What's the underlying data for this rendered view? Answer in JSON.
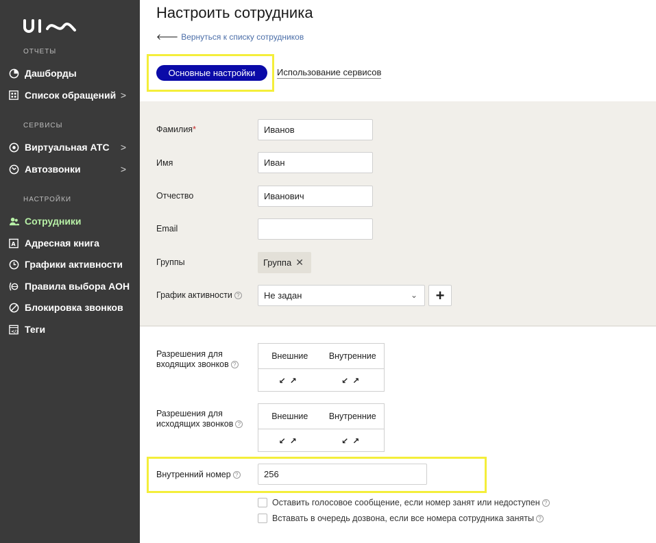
{
  "brand": {
    "logo_text": "uis"
  },
  "sidebar": {
    "sections": [
      {
        "title": "ОТЧЕТЫ"
      },
      {
        "title": "СЕРВИСЫ"
      },
      {
        "title": "НАСТРОЙКИ"
      }
    ],
    "items": [
      {
        "label": "Дашборды",
        "icon": "pie-chart-icon"
      },
      {
        "label": "Список обращений",
        "icon": "grid-list-icon",
        "chevron": ">"
      },
      {
        "label": "Виртуальная АТС",
        "icon": "pbx-icon",
        "chevron": ">"
      },
      {
        "label": "Автозвонки",
        "icon": "autocall-icon",
        "chevron": ">"
      },
      {
        "label": "Сотрудники",
        "icon": "users-icon",
        "active": true
      },
      {
        "label": "Адресная книга",
        "icon": "address-book-icon"
      },
      {
        "label": "Графики активности",
        "icon": "clock-icon"
      },
      {
        "label": "Правила выбора АОН",
        "icon": "caller-id-icon"
      },
      {
        "label": "Блокировка звонков",
        "icon": "block-icon"
      },
      {
        "label": "Теги",
        "icon": "tag-code-icon"
      }
    ]
  },
  "page": {
    "title": "Настроить сотрудника",
    "back_link": "Вернуться к списку сотрудников"
  },
  "tabs": {
    "primary": "Основные настройки",
    "secondary": "Использование сервисов"
  },
  "form": {
    "last_name": {
      "label": "Фамилия",
      "required_mark": "*",
      "value": "Иванов"
    },
    "first_name": {
      "label": "Имя",
      "value": "Иван"
    },
    "patronymic": {
      "label": "Отчество",
      "value": "Иванович"
    },
    "email": {
      "label": "Email",
      "value": ""
    },
    "groups": {
      "label": "Группы",
      "chip": "Группа",
      "chip_remove": "✕"
    },
    "schedule": {
      "label": "График активности",
      "value": "Не задан",
      "add": "+"
    },
    "incoming": {
      "label_line1": "Разрешения для",
      "label_line2": "входящих звонков",
      "col_external": "Внешние",
      "col_internal": "Внутренние",
      "arrows_external": "↙↗",
      "arrows_internal": "↙↗"
    },
    "outgoing": {
      "label_line1": "Разрешения для",
      "label_line2": "исходящих звонков",
      "col_external": "Внешние",
      "col_internal": "Внутренние",
      "arrows_external": "↙↗",
      "arrows_internal": "↙↗"
    },
    "internal_number": {
      "label": "Внутренний номер",
      "value": "256"
    },
    "voicemail": {
      "label": "Оставить голосовое сообщение, если номер занят или недоступен",
      "checked": false
    },
    "queue": {
      "label": "Вставать в очередь дозвона, если все номера сотрудника заняты",
      "checked": false
    }
  },
  "colors": {
    "sidebar_bg": "#3a3a3a",
    "active_item": "#b7f0a6",
    "primary_tab": "#0a0aa8",
    "highlight": "#f4ee3a",
    "panel_bg": "#f1efea",
    "link": "#4b6ea8"
  }
}
